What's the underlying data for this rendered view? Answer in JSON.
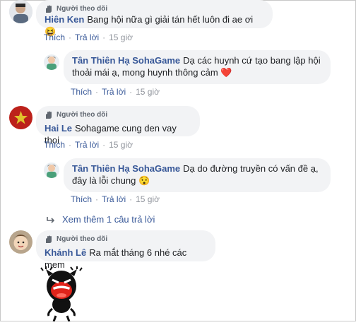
{
  "badge_label": "Người theo dõi",
  "action_like": "Thích",
  "action_reply": "Trả lời",
  "comments": [
    {
      "name": "Hiên Ken",
      "text": "Bang hội nữa gì giải tán hết luôn đi ae ơi😆",
      "time": "15 giờ",
      "reply": {
        "name": "Tân Thiên Hạ SohaGame",
        "text_line1": "Dạ các huynh cứ tạo bang lập hội",
        "text_line2": "thoải mái ạ, mong huynh thông cảm ❤️",
        "time": "15 giờ"
      }
    },
    {
      "name": "Hai Le",
      "text": "Sohagame cung den vay thoi",
      "time": "15 giờ",
      "reply": {
        "name": "Tân Thiên Hạ SohaGame",
        "text_line1": "Dạ do đường truyền có vấn đề ạ,",
        "text_line2": "đây là lỗi chung 😯",
        "time": "15 giờ"
      },
      "more_replies": "Xem thêm 1 câu trả lời"
    },
    {
      "name": "Khánh Lê",
      "text": "Ra mắt tháng 6 nhé các mem",
      "sticker": "laughing-devil-sticker"
    }
  ],
  "colors": {
    "link": "#385898",
    "bubble": "#f2f3f5",
    "meta": "#90949c"
  }
}
